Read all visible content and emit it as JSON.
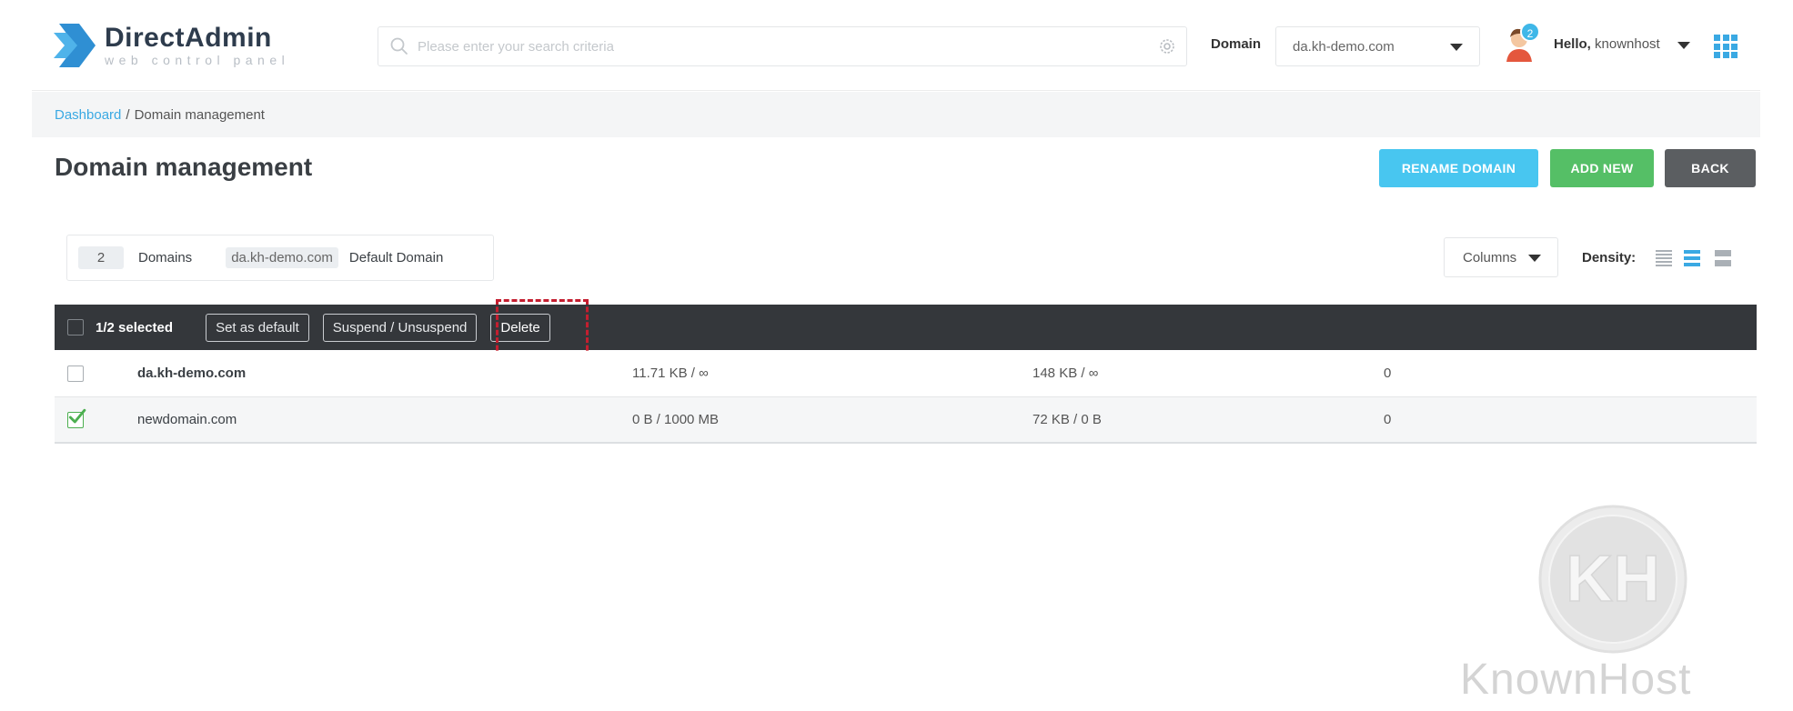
{
  "header": {
    "logo_title": "DirectAdmin",
    "logo_subtitle": "web control panel",
    "search_placeholder": "Please enter your search criteria",
    "domain_label": "Domain",
    "domain_value": "da.kh-demo.com",
    "notification_count": "2",
    "hello_prefix": "Hello,",
    "username": "knownhost"
  },
  "breadcrumb": {
    "home": "Dashboard",
    "separator": "/",
    "current": "Domain management"
  },
  "page": {
    "title": "Domain management",
    "buttons": {
      "rename": "RENAME DOMAIN",
      "add_new": "ADD NEW",
      "back": "BACK"
    }
  },
  "summary": {
    "count": "2",
    "count_label": "Domains",
    "default_domain": "da.kh-demo.com",
    "default_label": "Default Domain"
  },
  "toolbar": {
    "columns_label": "Columns",
    "density_label": "Density:"
  },
  "actions": {
    "selected_text": "1/2 selected",
    "set_default": "Set as default",
    "suspend": "Suspend / Unsuspend",
    "delete": "Delete"
  },
  "rows": [
    {
      "name": "da.kh-demo.com",
      "bandwidth": "11.71 KB / ∞",
      "disk": "148 KB / ∞",
      "subdomains": "0",
      "checked": false
    },
    {
      "name": "newdomain.com",
      "bandwidth": "0 B / 1000 MB",
      "disk": "72 KB / 0 B",
      "subdomains": "0",
      "checked": true
    }
  ],
  "watermark": {
    "text": "KnownHost",
    "mark": "KH"
  },
  "colors": {
    "accent_blue": "#3aa9e3",
    "rename_button": "#48c6f0",
    "add_button": "#55bf66",
    "back_button": "#5b5e61",
    "action_bar": "#34373b",
    "highlight_red": "#c41e2f",
    "check_green": "#4caf50"
  }
}
